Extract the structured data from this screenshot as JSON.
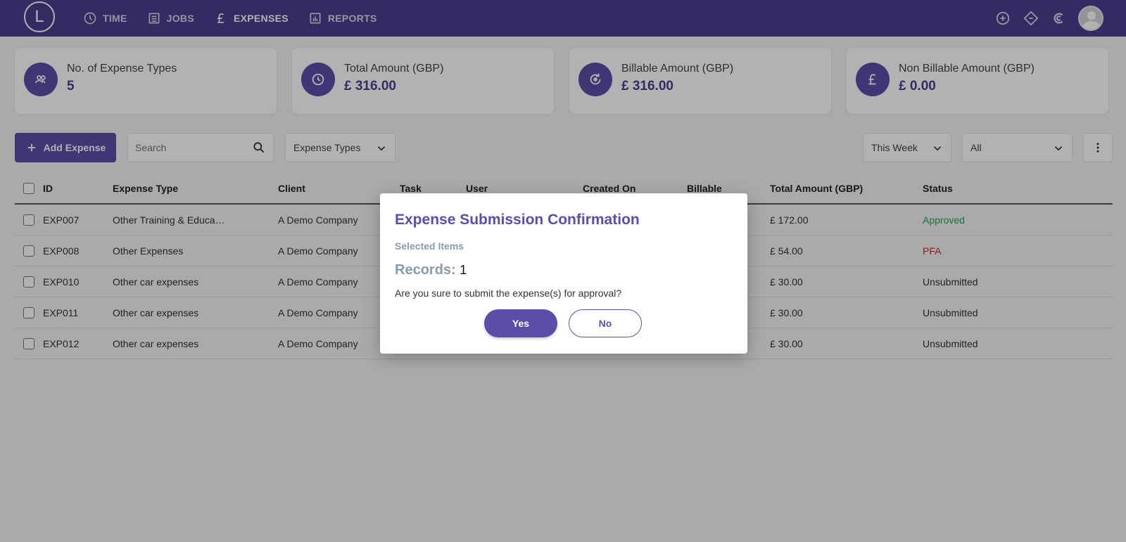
{
  "app": {
    "logo_letter": "L"
  },
  "nav": {
    "items": [
      {
        "label": "TIME",
        "icon": "clock-icon"
      },
      {
        "label": "JOBS",
        "icon": "list-icon"
      },
      {
        "label": "EXPENSES",
        "icon": "pound-icon",
        "active": true
      },
      {
        "label": "REPORTS",
        "icon": "bar-chart-icon"
      }
    ]
  },
  "stats": [
    {
      "label": "No. of Expense Types",
      "value": "5",
      "icon": "users-icon"
    },
    {
      "label": "Total Amount (GBP)",
      "value": "£ 316.00",
      "icon": "clock-icon"
    },
    {
      "label": "Billable Amount (GBP)",
      "value": "£ 316.00",
      "icon": "refresh-icon"
    },
    {
      "label": "Non Billable Amount (GBP)",
      "value": "£ 0.00",
      "icon": "pound-icon"
    }
  ],
  "toolbar": {
    "add_label": "Add Expense",
    "search_placeholder": "Search",
    "expense_types": "Expense Types",
    "period": "This Week",
    "status_filter": "All"
  },
  "table": {
    "headers": [
      "ID",
      "Expense Type",
      "Client",
      "Task",
      "User",
      "Created On",
      "Billable",
      "Total Amount (GBP)",
      "Status"
    ],
    "rows": [
      {
        "id": "EXP007",
        "type": "Other Training & Educa…",
        "client": "A Demo Company",
        "amount": "£ 172.00",
        "status": "Approved"
      },
      {
        "id": "EXP008",
        "type": "Other Expenses",
        "client": "A Demo Company",
        "amount": "£ 54.00",
        "status": "PFA"
      },
      {
        "id": "EXP010",
        "type": "Other car expenses",
        "client": "A Demo Company",
        "amount": "£ 30.00",
        "status": "Unsubmitted"
      },
      {
        "id": "EXP011",
        "type": "Other car expenses",
        "client": "A Demo Company",
        "amount": "£ 30.00",
        "status": "Unsubmitted"
      },
      {
        "id": "EXP012",
        "type": "Other car expenses",
        "client": "A Demo Company",
        "amount": "£ 30.00",
        "status": "Unsubmitted"
      }
    ]
  },
  "modal": {
    "title": "Expense Submission Confirmation",
    "selected_label": "Selected Items",
    "records_label": "Records:",
    "records_value": "1",
    "question": "Are you sure to submit the expense(s) for approval?",
    "yes_label": "Yes",
    "no_label": "No"
  },
  "colors": {
    "nav_bg": "#4a3f8f",
    "accent": "#5b4ea8",
    "approved": "#22a94a",
    "pfa": "#c62828"
  }
}
